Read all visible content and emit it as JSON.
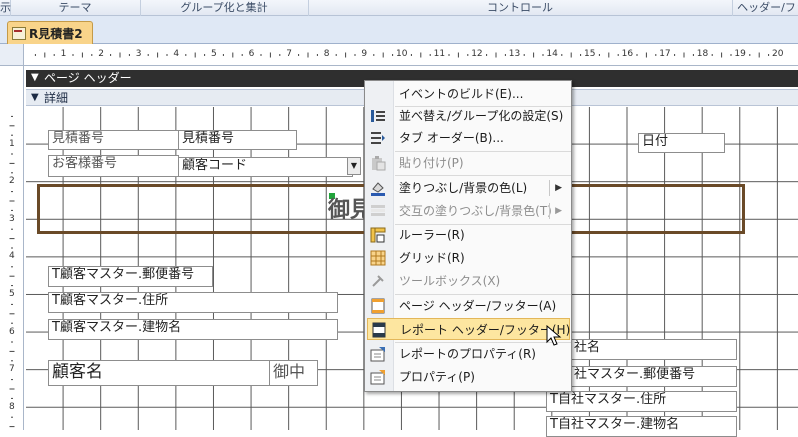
{
  "ribbon": {
    "groups": [
      "示",
      "テーマ",
      "グループ化と集計",
      "コントロール",
      "ヘッダー/フッタ"
    ]
  },
  "document_tab": {
    "label": "R見積書2",
    "icon": "report-icon"
  },
  "ruler": {
    "horizontal": [
      "1",
      "2",
      "3",
      "4",
      "5",
      "6",
      "7",
      "8",
      "9",
      "10",
      "11",
      "12",
      "13",
      "14",
      "15",
      "16",
      "17",
      "18",
      "19",
      "20"
    ],
    "vertical": [
      "1",
      "2",
      "3",
      "4",
      "5",
      "6",
      "7",
      "8"
    ]
  },
  "sections": {
    "page_header": "ページ ヘッダー",
    "detail": "詳細"
  },
  "controls": {
    "estimate_no_label": "見積番号",
    "estimate_no_field": "見積番号",
    "customer_no_label": "お客様番号",
    "customer_code_field": "顧客コード",
    "title": "御見",
    "date_field": "日付",
    "postal_code_field": "T顧客マスター.郵便番号",
    "address_field": "T顧客マスター.住所",
    "building_field": "T顧客マスター.建物名",
    "customer_name_field": "顧客名",
    "honorific": "御中",
    "company_name_field": "社名",
    "company_postal_field": "社マスター.郵便番号",
    "company_address_field": "T自社マスター.住所",
    "company_building_field": "T自社マスター.建物名"
  },
  "context_menu": {
    "items": [
      {
        "label": "イベントのビルド(E)...",
        "icon": "",
        "disabled": false
      },
      {
        "label": "並べ替え/グループ化の設定(S)",
        "icon": "sort-group-icon",
        "disabled": false
      },
      {
        "label": "タブ オーダー(B)...",
        "icon": "tab-order-icon",
        "disabled": false
      },
      {
        "label": "貼り付け(P)",
        "icon": "paste-icon",
        "disabled": true
      },
      {
        "label": "塗りつぶし/背景の色(L)",
        "icon": "fill-color-icon",
        "disabled": false,
        "submenu": true
      },
      {
        "label": "交互の塗りつぶし/背景色(T)",
        "icon": "alternate-fill-icon",
        "disabled": true,
        "submenu": true
      },
      {
        "label": "ルーラー(R)",
        "icon": "ruler-icon",
        "disabled": false
      },
      {
        "label": "グリッド(R)",
        "icon": "grid-icon",
        "disabled": false
      },
      {
        "label": "ツールボックス(X)",
        "icon": "toolbox-icon",
        "disabled": true
      },
      {
        "label": "ページ ヘッダー/フッター(A)",
        "icon": "page-header-footer-icon",
        "disabled": false
      },
      {
        "label": "レポート ヘッダー/フッター(H)",
        "icon": "report-header-footer-icon",
        "disabled": false,
        "highlighted": true
      },
      {
        "label": "レポートのプロパティ(R)",
        "icon": "report-properties-icon",
        "disabled": false
      },
      {
        "label": "プロパティ(P)",
        "icon": "properties-icon",
        "disabled": false
      }
    ]
  },
  "colors": {
    "menu_highlight": "#fde6a0",
    "tab_bg": "#f9d48a",
    "title_frame": "#6a4a28",
    "page_header_band": "#2f2f2f"
  }
}
